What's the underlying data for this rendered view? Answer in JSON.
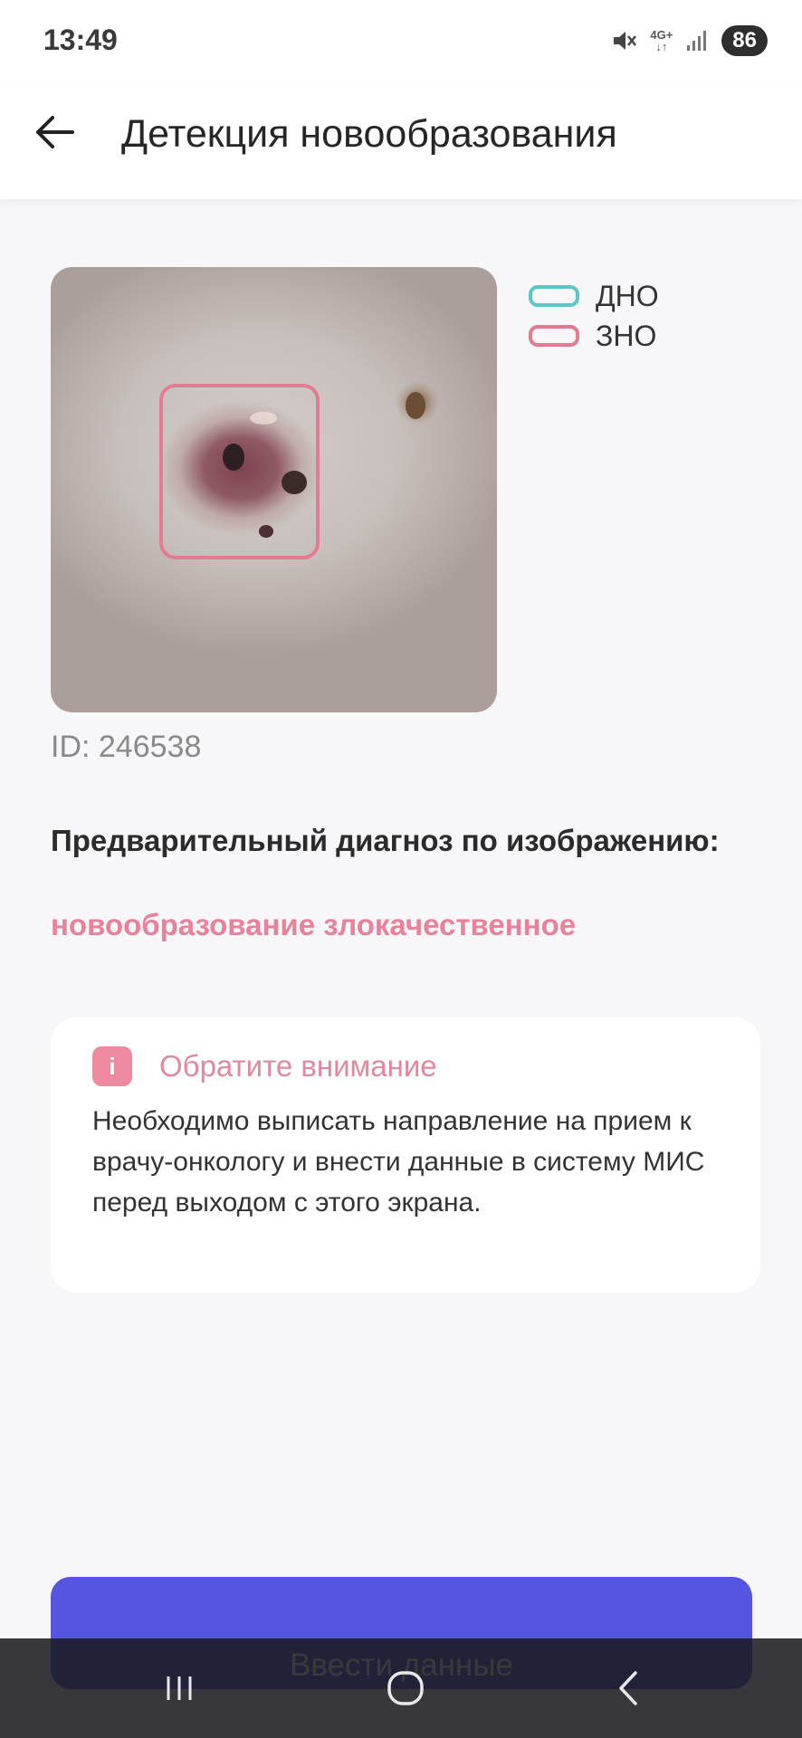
{
  "status_bar": {
    "time": "13:49",
    "network": "4G+",
    "battery": "86"
  },
  "header": {
    "title": "Детекция новообразования"
  },
  "detection": {
    "legend": [
      {
        "label": "ДНО",
        "color": "#5cc6c9"
      },
      {
        "label": "ЗНО",
        "color": "#e57a93"
      }
    ],
    "image_id": "ID: 246538"
  },
  "diagnosis": {
    "label": "Предварительный диагноз по изображению:",
    "value": "новообразование злокачественное"
  },
  "notice": {
    "icon": "i",
    "title": "Обратите внимание",
    "text": "Необходимо выписать направление на прием к врачу-онкологу и внести данные в систему МИС перед выходом с этого экрана."
  },
  "actions": {
    "enter_data_label": "Ввести данные"
  },
  "nav_bar": {
    "icons": [
      "recent-apps-icon",
      "home-icon",
      "back-icon"
    ]
  }
}
